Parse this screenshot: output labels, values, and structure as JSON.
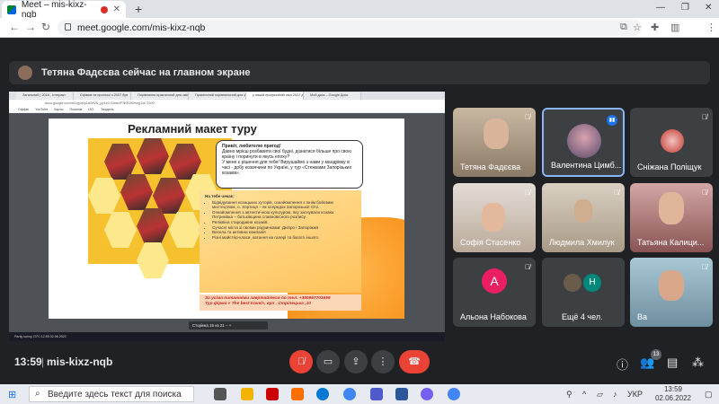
{
  "browser": {
    "tab_title": "Meet – mis-kixz-nqb",
    "new_tab_symbol": "+",
    "url": "meet.google.com/mis-kixz-nqb",
    "profile_initial": "A"
  },
  "banner": {
    "text": "Тетяна Фадєєва сейчас на главном экране"
  },
  "shared_screen": {
    "inner_tabs": [
      "Загальний | 2018 - Інтеракт.",
      "Єфімов та прогнозі з 2007 був",
      "Порівняння практичний для зміни",
      "Практичний порівняльний для зміни",
      "у нашій професійній свої 2022 для",
      "Мой диск – Google Диск"
    ],
    "inner_url": "docs.google.com/d/1rg/a0p1d2eVK_pp1c0 Gmwr/F3KE0i9/ncg.2d/ 2000",
    "bookmarks": [
      "Оффісі",
      "YouTube",
      "Карты",
      "Позитив ІЗО: Тиждень"
    ],
    "slide": {
      "title": "Рекламний макет туру",
      "bubble_lines": [
        "Привіт, любителю пригод!",
        "Давно мрієш розбавити свої будні, дізнатися більше про свою країну і поринути в якусь епоху?",
        "У мене є рішення для тебе! Вирушаймо з нами у мандрівку в часі - добу козаччини по Україні, у тур «Стежками Запорізьких козаків»."
      ],
      "info_head": "На тебе чекає:",
      "info_items": [
        "Відвідування козацьких хуторів, ознайомлення з їхнім бойовим мистецтвом, о. Хортиця – як осередок Запорозької Січі.",
        "Ознайомлення з автентичною культурою, яку заснували козаки. Петриківка – батьківщина славновісного розпису.",
        "Реліквіна стародавня козаків.",
        "Сучасні міста зі своїми родзинками: Дніпро і Запоріжжя",
        "Весела та активна компанія",
        "Різні майстер-класи, катання на галері та багато іншого"
      ],
      "contact_line1": "За усіма питаннями звертайтеся по тел. +380967701659",
      "contact_line2": "Тур фірма « The best travel», вул . Стрілецька ,10"
    },
    "pager": "Сторінка 16 из 21 − +",
    "inner_taskbar": "Partly sunny  23°C  12:55 02.06.2022"
  },
  "participants": [
    {
      "name": "Тетяна Фадєєва",
      "muted": true
    },
    {
      "name": "Валентина Цимб...",
      "muted": false,
      "speaking": true
    },
    {
      "name": "Сніжана Поліщук",
      "muted": true
    },
    {
      "name": "Софія Стасенко",
      "muted": true
    },
    {
      "name": "Людмила Хмилук",
      "muted": true
    },
    {
      "name": "Татьяна Калици...",
      "muted": true
    },
    {
      "name": "Альона Набокова",
      "muted": true,
      "initial": "А"
    },
    {
      "name": "Ещё 4 чел.",
      "initial": "Н"
    },
    {
      "name": "Ва",
      "muted": true
    }
  ],
  "bottombar": {
    "time": "13:59",
    "meeting_code": "mis-kixz-nqb",
    "people_count": "13"
  },
  "taskbar": {
    "search_placeholder": "Введите здесь текст для поиска",
    "lang": "УКР",
    "clock_time": "13:59",
    "clock_date": "02.06.2022"
  },
  "colors": {
    "meet_bg": "#202124",
    "accent": "#8ab4f8",
    "end_call": "#ea4335",
    "slide_orange": "#f6c12e"
  }
}
